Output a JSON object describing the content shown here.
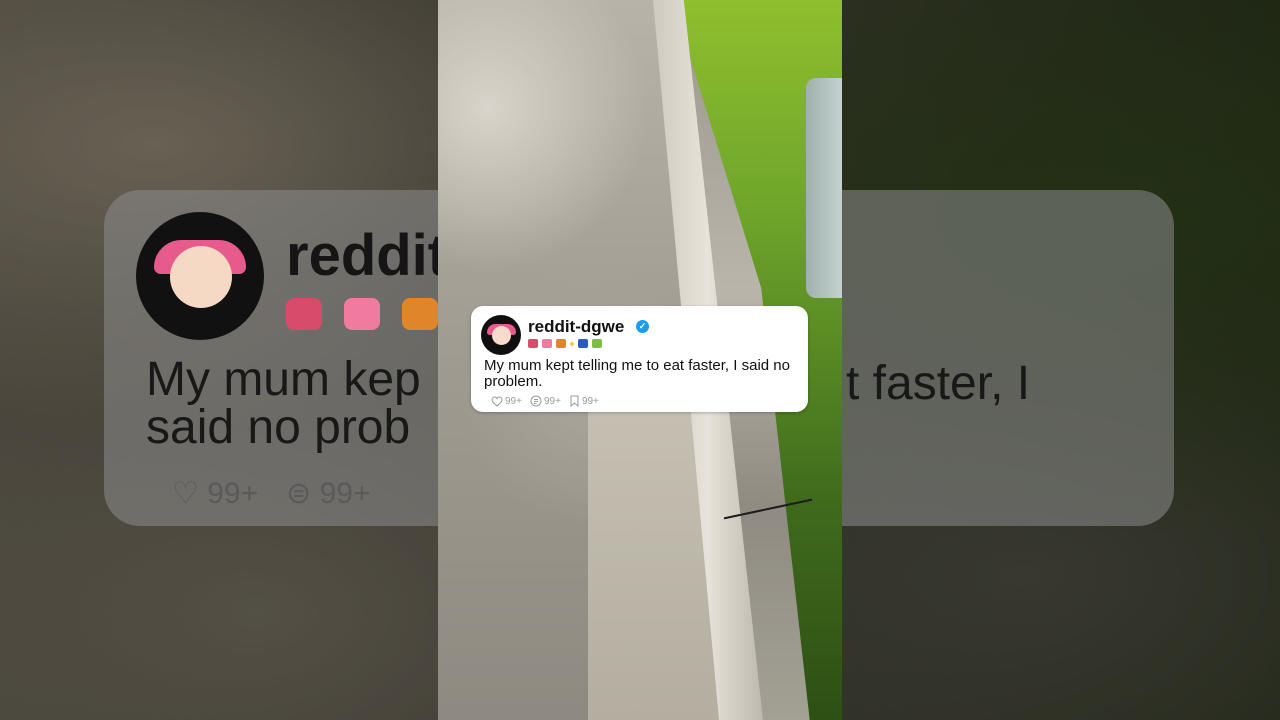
{
  "post": {
    "username": "reddit-dgwe",
    "verified": true,
    "badge_colors": [
      "#d84b6b",
      "#f07aa0",
      "#e0862a",
      "#f2c94c",
      "#2b59c3",
      "#7fbf3f"
    ],
    "text": "My mum kept telling me to eat faster, I said no problem.",
    "stats": {
      "likes": "99+",
      "comments": "99+",
      "saves": "99+"
    }
  },
  "background": {
    "username_fragment": "reddit",
    "text_fragment_left": "My mum kep",
    "text_fragment_left_line2": "said no prob",
    "text_fragment_right": "t faster, I",
    "stat_likes": "99+",
    "stat_comments": "99+"
  },
  "colors": {
    "verified_badge": "#1d9bf0",
    "card_background": "#ffffff",
    "stat_text": "#9a9a9a"
  }
}
